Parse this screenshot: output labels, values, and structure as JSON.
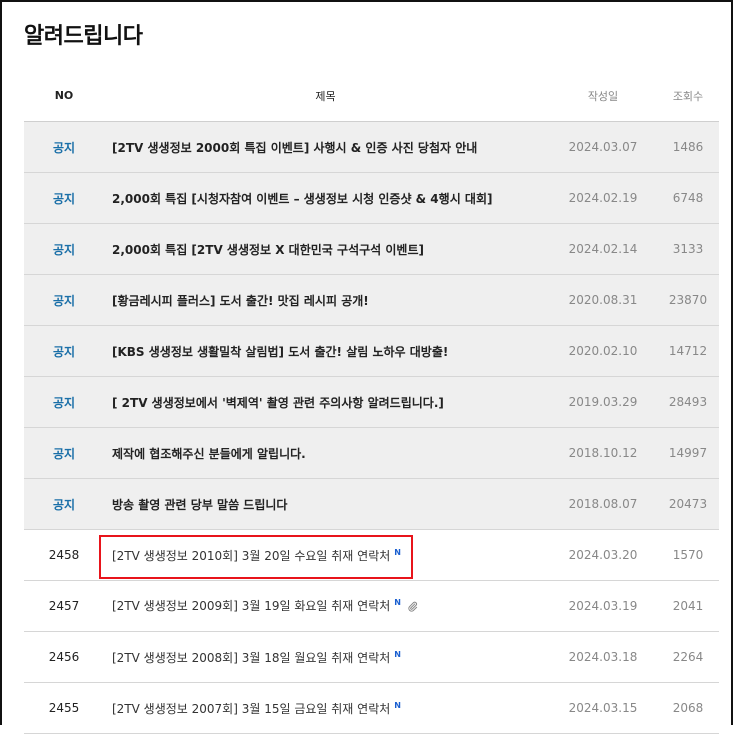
{
  "page": {
    "title": "알려드립니다"
  },
  "table": {
    "headers": {
      "no": "NO",
      "title": "제목",
      "date": "작성일",
      "views": "조회수"
    },
    "notices": [
      {
        "no": "공지",
        "title": "[2TV 생생정보 2000회 특집 이벤트] 사행시 & 인증 사진 당첨자 안내",
        "date": "2024.03.07",
        "views": "1486"
      },
      {
        "no": "공지",
        "title": "2,000회 특집 [시청자참여 이벤트 – 생생정보 시청 인증샷 & 4행시 대회]",
        "date": "2024.02.19",
        "views": "6748"
      },
      {
        "no": "공지",
        "title": "2,000회 특집 [2TV 생생정보 X 대한민국 구석구석 이벤트]",
        "date": "2024.02.14",
        "views": "3133"
      },
      {
        "no": "공지",
        "title": "[황금레시피 플러스] 도서 출간! 맛집 레시피 공개!",
        "date": "2020.08.31",
        "views": "23870"
      },
      {
        "no": "공지",
        "title": "[KBS 생생정보 생활밀착 살림법] 도서 출간! 살림 노하우 대방출!",
        "date": "2020.02.10",
        "views": "14712"
      },
      {
        "no": "공지",
        "title": "[ 2TV 생생정보에서 '벽제역' 촬영 관련 주의사항 알려드립니다.]",
        "date": "2019.03.29",
        "views": "28493"
      },
      {
        "no": "공지",
        "title": "제작에 협조해주신 분들에게 알립니다.",
        "date": "2018.10.12",
        "views": "14997"
      },
      {
        "no": "공지",
        "title": "방송 촬영 관련 당부 말씀 드립니다",
        "date": "2018.08.07",
        "views": "20473"
      }
    ],
    "posts": [
      {
        "no": "2458",
        "title": "[2TV 생생정보 2010회] 3월 20일 수요일 취재 연락처",
        "badge": "N",
        "date": "2024.03.20",
        "views": "1570"
      },
      {
        "no": "2457",
        "title": "[2TV 생생정보 2009회] 3월 19일 화요일 취재 연락처",
        "badge": "N",
        "date": "2024.03.19",
        "views": "2041"
      },
      {
        "no": "2456",
        "title": "[2TV 생생정보 2008회] 3월 18일 월요일 취재 연락처",
        "badge": "N",
        "date": "2024.03.18",
        "views": "2264"
      },
      {
        "no": "2455",
        "title": "[2TV 생생정보 2007회] 3월 15일 금요일 취재 연락처",
        "badge": "N",
        "date": "2024.03.15",
        "views": "2068"
      }
    ]
  },
  "icons": {
    "attachment": "paperclip-icon"
  },
  "colors": {
    "notice_label": "#1a6fa8",
    "new_badge": "#1a5fd0",
    "highlight": "#e8141b"
  }
}
